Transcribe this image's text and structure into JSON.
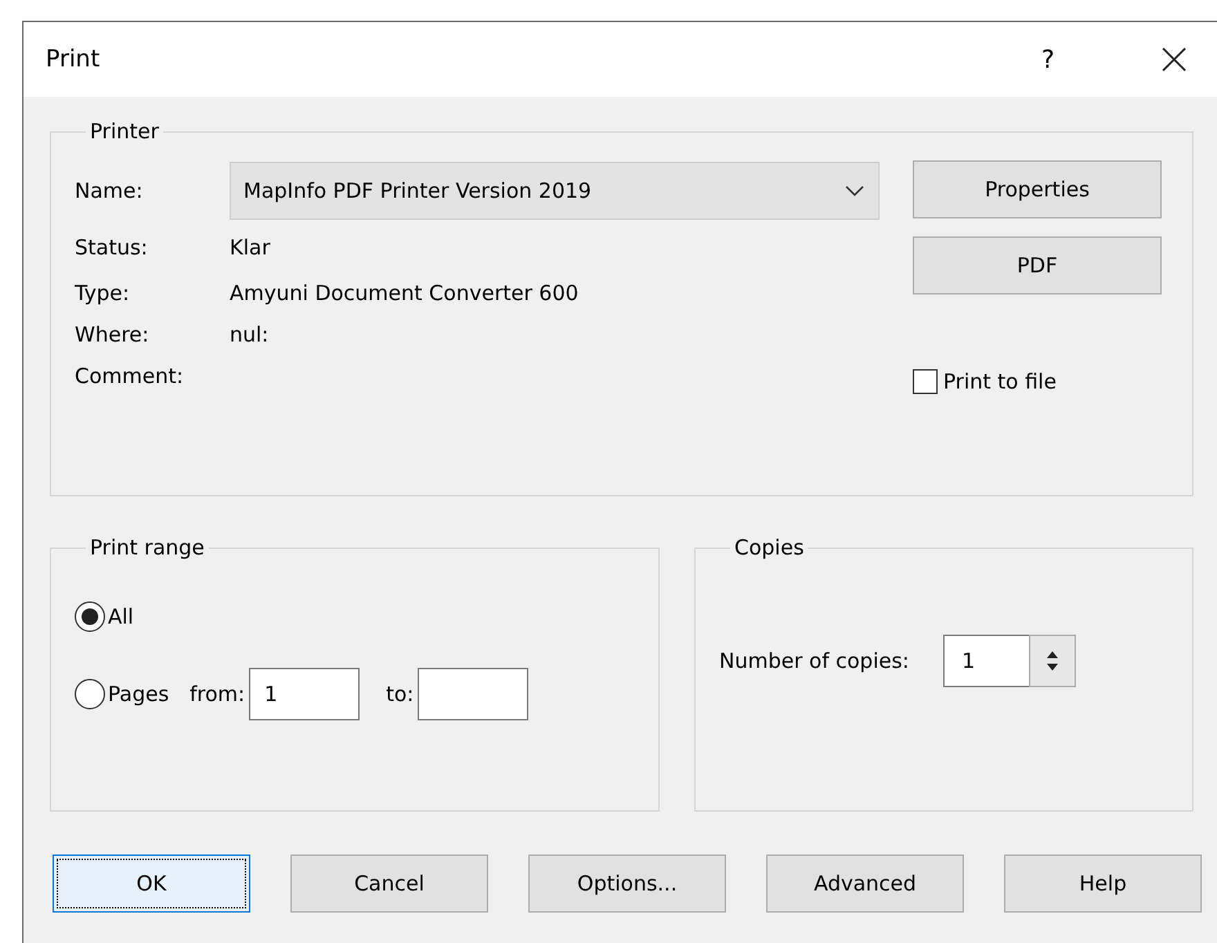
{
  "window": {
    "title": "Print",
    "help": "?"
  },
  "printer": {
    "legend": "Printer",
    "fields": [
      {
        "kind": "select",
        "label": "Name:",
        "value": "MapInfo PDF Printer Version 2019"
      },
      {
        "kind": "text",
        "label": "Status:",
        "value": "Klar"
      },
      {
        "kind": "text",
        "label": "Type:",
        "value": "Amyuni Document Converter 600"
      },
      {
        "kind": "text",
        "label": "Where:",
        "value": "nul:"
      },
      {
        "kind": "text",
        "label": "Comment:"
      }
    ],
    "buttons": [
      "Properties",
      "PDF"
    ],
    "print_to_file": {
      "label": "Print to file",
      "checked": false
    }
  },
  "print_range": {
    "legend": "Print range",
    "options": [
      {
        "label": "All",
        "selected": true
      },
      {
        "label": "Pages",
        "selected": false
      }
    ],
    "from": {
      "label": "from:",
      "value": "1"
    },
    "to": {
      "label": "to:"
    }
  },
  "copies": {
    "legend": "Copies",
    "label": "Number of copies:",
    "value": "1"
  },
  "buttons": [
    {
      "label": "OK",
      "default": true
    },
    {
      "label": "Cancel",
      "default": false
    },
    {
      "label": "Options...",
      "default": false
    },
    {
      "label": "Advanced",
      "default": false
    },
    {
      "label": "Help",
      "default": false
    }
  ]
}
